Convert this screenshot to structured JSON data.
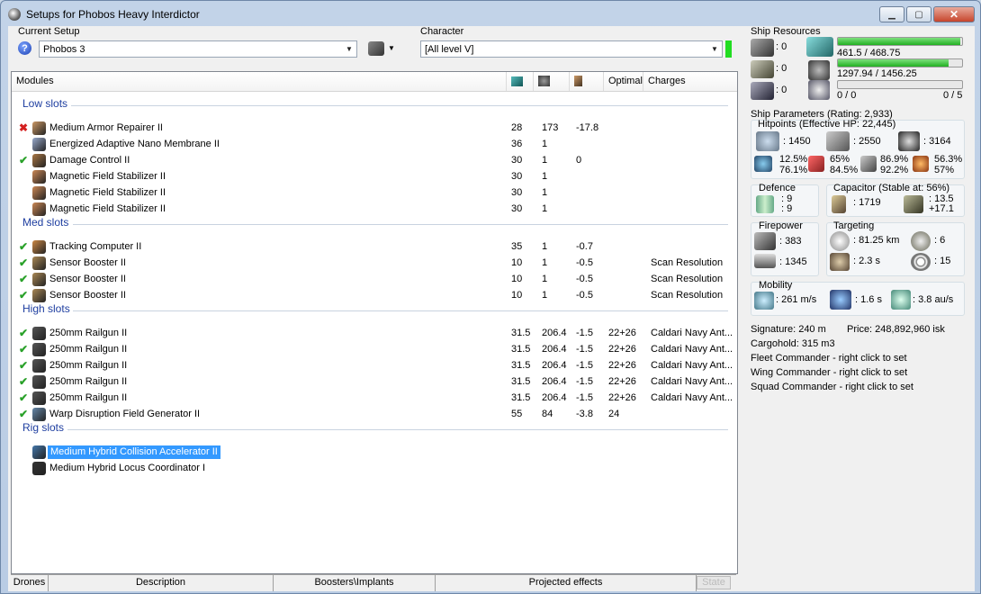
{
  "window": {
    "title": "Setups for Phobos Heavy Interdictor"
  },
  "setup": {
    "label": "Current Setup",
    "value": "Phobos 3"
  },
  "character": {
    "label": "Character",
    "value": "[All level V]"
  },
  "columns": {
    "modules": "Modules",
    "optimal": "Optimal",
    "charges": "Charges"
  },
  "groups": {
    "low": "Low slots",
    "med": "Med slots",
    "high": "High slots",
    "rig": "Rig slots"
  },
  "rows": [
    {
      "status": "x",
      "name": "Medium Armor Repairer II",
      "cpu": "28",
      "pg": "173",
      "cap": "-17.8",
      "opt": "",
      "charge": ""
    },
    {
      "status": "",
      "name": "Energized Adaptive Nano Membrane II",
      "cpu": "36",
      "pg": "1",
      "cap": "",
      "opt": "",
      "charge": ""
    },
    {
      "status": "ok",
      "name": "Damage Control II",
      "cpu": "30",
      "pg": "1",
      "cap": "0",
      "opt": "",
      "charge": ""
    },
    {
      "status": "",
      "name": "Magnetic Field Stabilizer II",
      "cpu": "30",
      "pg": "1",
      "cap": "",
      "opt": "",
      "charge": ""
    },
    {
      "status": "",
      "name": "Magnetic Field Stabilizer II",
      "cpu": "30",
      "pg": "1",
      "cap": "",
      "opt": "",
      "charge": ""
    },
    {
      "status": "",
      "name": "Magnetic Field Stabilizer II",
      "cpu": "30",
      "pg": "1",
      "cap": "",
      "opt": "",
      "charge": ""
    },
    {
      "status": "ok",
      "name": "Tracking Computer II",
      "cpu": "35",
      "pg": "1",
      "cap": "-0.7",
      "opt": "",
      "charge": ""
    },
    {
      "status": "ok",
      "name": "Sensor Booster II",
      "cpu": "10",
      "pg": "1",
      "cap": "-0.5",
      "opt": "",
      "charge": "Scan Resolution"
    },
    {
      "status": "ok",
      "name": "Sensor Booster II",
      "cpu": "10",
      "pg": "1",
      "cap": "-0.5",
      "opt": "",
      "charge": "Scan Resolution"
    },
    {
      "status": "ok",
      "name": "Sensor Booster II",
      "cpu": "10",
      "pg": "1",
      "cap": "-0.5",
      "opt": "",
      "charge": "Scan Resolution"
    },
    {
      "status": "ok",
      "name": "250mm Railgun II",
      "cpu": "31.5",
      "pg": "206.4",
      "cap": "-1.5",
      "opt": "22+26",
      "charge": "Caldari Navy Ant..."
    },
    {
      "status": "ok",
      "name": "250mm Railgun II",
      "cpu": "31.5",
      "pg": "206.4",
      "cap": "-1.5",
      "opt": "22+26",
      "charge": "Caldari Navy Ant..."
    },
    {
      "status": "ok",
      "name": "250mm Railgun II",
      "cpu": "31.5",
      "pg": "206.4",
      "cap": "-1.5",
      "opt": "22+26",
      "charge": "Caldari Navy Ant..."
    },
    {
      "status": "ok",
      "name": "250mm Railgun II",
      "cpu": "31.5",
      "pg": "206.4",
      "cap": "-1.5",
      "opt": "22+26",
      "charge": "Caldari Navy Ant..."
    },
    {
      "status": "ok",
      "name": "250mm Railgun II",
      "cpu": "31.5",
      "pg": "206.4",
      "cap": "-1.5",
      "opt": "22+26",
      "charge": "Caldari Navy Ant..."
    },
    {
      "status": "ok",
      "name": "Warp Disruption Field Generator II",
      "cpu": "55",
      "pg": "84",
      "cap": "-3.8",
      "opt": "24",
      "charge": ""
    },
    {
      "status": "",
      "name": "Medium Hybrid Collision Accelerator II",
      "cpu": "",
      "pg": "",
      "cap": "",
      "opt": "",
      "charge": ""
    },
    {
      "status": "",
      "name": "Medium Hybrid Locus Coordinator I",
      "cpu": "",
      "pg": "",
      "cap": "",
      "opt": "",
      "charge": ""
    }
  ],
  "bottom_tabs": {
    "drones": "Drones",
    "description": "Description",
    "boosters": "Boosters\\Implants",
    "projected": "Projected effects",
    "state": "State"
  },
  "resources": {
    "title": "Ship Resources",
    "hi": ": 0",
    "med": ": 0",
    "low": ": 0",
    "cpu": "461.5 / 468.75",
    "cpu_frac": 0.985,
    "pg": "1297.94 / 1456.25",
    "pg_frac": 0.89,
    "calib": "0 / 0",
    "drones": "0 / 5",
    "calib_frac": 0.0
  },
  "params": {
    "title": "Ship Parameters (Rating: 2,933)",
    "hp_title": "Hitpoints (Effective HP: 22,445)",
    "shield": ": 1450",
    "armor": ": 2550",
    "hull": ": 3164",
    "res": {
      "em_a": "12.5%",
      "em_b": "76.1%",
      "th_a": "65%",
      "th_b": "84.5%",
      "ki_a": "86.9%",
      "ki_b": "92.2%",
      "ex_a": "56.3%",
      "ex_b": "57%"
    },
    "defence_title": "Defence",
    "def_a": ": 9",
    "def_b": ": 9",
    "cap_title": "Capacitor (Stable at: 56%)",
    "cap_val": ": 1719",
    "cap_a": ": 13.5",
    "cap_b": "+17.1",
    "fire_title": "Firepower",
    "fire_a": ": 383",
    "fire_b": ": 1345",
    "tgt_title": "Targeting",
    "tgt_range": ": 81.25 km",
    "tgt_count": ": 6",
    "tgt_time": ": 2.3 s",
    "tgt_res": ": 15",
    "mob_title": "Mobility",
    "speed": ": 261 m/s",
    "align": ": 1.6 s",
    "warp": ": 3.8 au/s",
    "signature": "Signature: 240 m",
    "price": "Price: 248,892,960 isk",
    "cargo": "Cargohold: 315 m3",
    "fleet": "Fleet Commander - right click to set",
    "wing": "Wing Commander - right click to set",
    "squad": "Squad Commander - right click to set"
  }
}
